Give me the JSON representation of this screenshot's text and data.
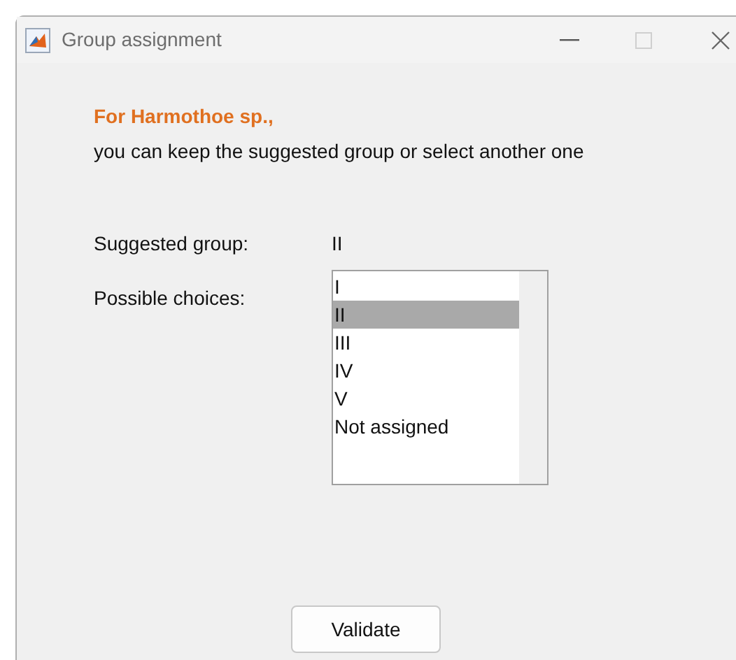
{
  "window": {
    "title": "Group assignment"
  },
  "heading": "For Harmothoe sp.,",
  "message": "you can keep the suggested group or select another one",
  "suggested": {
    "label": "Suggested group:",
    "value": "II"
  },
  "choices": {
    "label": "Possible choices:",
    "items": [
      {
        "label": "I",
        "selected": false
      },
      {
        "label": "II",
        "selected": true
      },
      {
        "label": "III",
        "selected": false
      },
      {
        "label": "IV",
        "selected": false
      },
      {
        "label": "V",
        "selected": false
      },
      {
        "label": "Not assigned",
        "selected": false
      }
    ]
  },
  "buttons": [
    "Validate"
  ]
}
